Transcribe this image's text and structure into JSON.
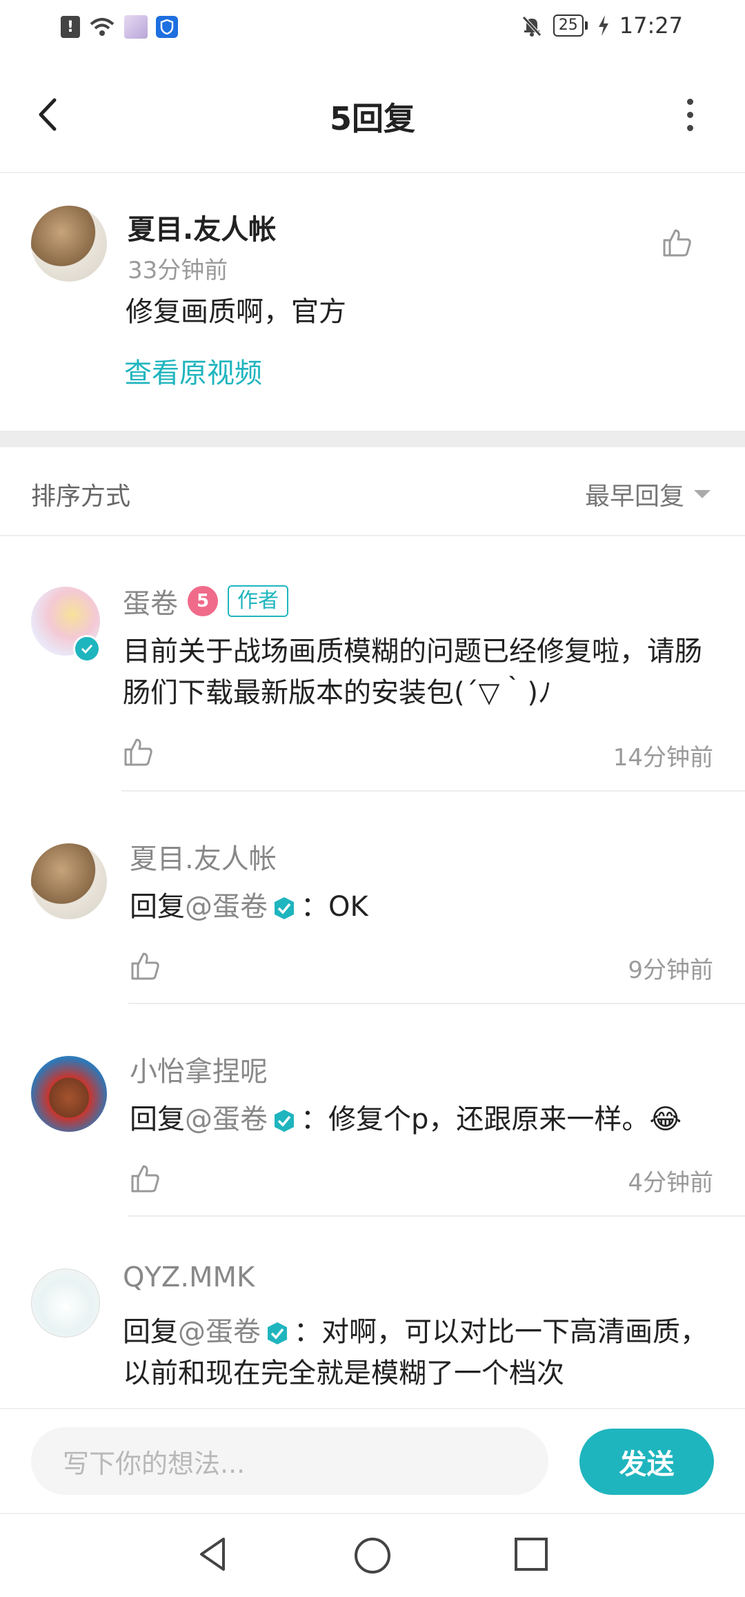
{
  "status_bar": {
    "time": "17:27",
    "battery": "25",
    "icons": [
      "alert-icon",
      "wifi-icon",
      "app-avatar-icon",
      "shield-icon",
      "mute-bell-icon",
      "battery-icon",
      "charging-icon"
    ]
  },
  "header": {
    "title": "5回复"
  },
  "top_comment": {
    "author": "夏目.友人帐",
    "time": "33分钟前",
    "content": "修复画质啊，官方",
    "link": "查看原视频"
  },
  "sort": {
    "label": "排序方式",
    "value": "最早回复"
  },
  "replies": [
    {
      "author": "蛋卷",
      "level": "5",
      "badge": "作者",
      "content": "目前关于战场画质模糊的问题已经修复啦，请肠肠们下载最新版本的安装包(´▽｀)ﾉ",
      "time": "14分钟前"
    },
    {
      "author": "夏目.友人帐",
      "reply_prefix": "回复",
      "mention": "@蛋卷",
      "content": "：OK",
      "time": "9分钟前"
    },
    {
      "author": "小怡拿捏呢",
      "reply_prefix": "回复",
      "mention": "@蛋卷",
      "content": "：修复个p，还跟原来一样。",
      "emoji": "😂",
      "time": "4分钟前"
    },
    {
      "author": "QYZ.MMK",
      "reply_prefix": "回复",
      "mention": "@蛋卷",
      "content": "：对啊，可以对比一下高清画质，以前和现在完全就是模糊了一个档次"
    }
  ],
  "input": {
    "placeholder": "写下你的想法...",
    "send_label": "发送"
  },
  "colors": {
    "accent": "#1fb5be",
    "level_badge": "#f06b8a"
  }
}
